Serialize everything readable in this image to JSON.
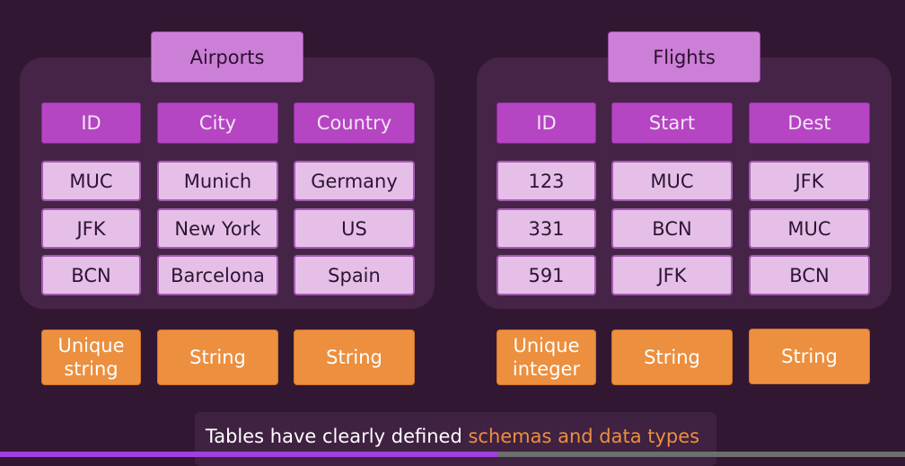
{
  "tables": [
    {
      "title": "Airports",
      "columns": [
        "ID",
        "City",
        "Country"
      ],
      "rows": [
        [
          "MUC",
          "Munich",
          "Germany"
        ],
        [
          "JFK",
          "New York",
          "US"
        ],
        [
          "BCN",
          "Barcelona",
          "Spain"
        ]
      ],
      "types": [
        [
          "Unique",
          "string"
        ],
        [
          "String"
        ],
        [
          "String"
        ]
      ]
    },
    {
      "title": "Flights",
      "columns": [
        "ID",
        "Start",
        "Dest"
      ],
      "rows": [
        [
          "123",
          "MUC",
          "JFK"
        ],
        [
          "331",
          "BCN",
          "MUC"
        ],
        [
          "591",
          "JFK",
          "BCN"
        ]
      ],
      "types": [
        [
          "Unique",
          "integer"
        ],
        [
          "String"
        ],
        [
          "String"
        ]
      ]
    }
  ],
  "caption": {
    "text": "Tables have clearly defined ",
    "highlight": "schemas and data types"
  },
  "progress": 0.55,
  "colors": {
    "background": "#321733",
    "panel": "#462448",
    "header": "#b545c3",
    "cell": "#e6bfe9",
    "type": "#ec8f3e",
    "progress": "#a040e0"
  }
}
